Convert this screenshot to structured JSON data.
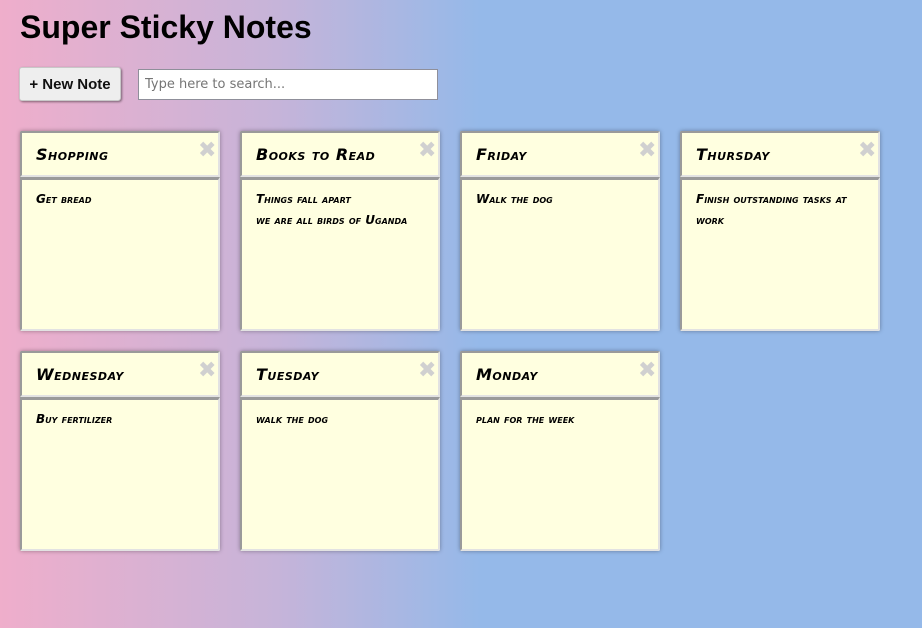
{
  "app": {
    "title": "Super Sticky Notes"
  },
  "toolbar": {
    "new_note_label": "+ New Note",
    "search_placeholder": "Type here to search...",
    "search_value": ""
  },
  "colors": {
    "note_background": "#ffffe0",
    "gradient_start": "#efaecb",
    "gradient_end": "#95b9e9",
    "close_icon": "#d0d0d0"
  },
  "notes": [
    {
      "title": "Shopping",
      "body": "Get bread",
      "close_icon": "close-x"
    },
    {
      "title": "Books to Read",
      "body": "Things fall apart\nwe are all birds of Uganda",
      "close_icon": "close-x"
    },
    {
      "title": "Friday",
      "body": "Walk the dog",
      "close_icon": "close-x"
    },
    {
      "title": "Thursday",
      "body": "Finish outstanding tasks at work",
      "close_icon": "close-x"
    },
    {
      "title": "Wednesday",
      "body": "Buy fertilizer",
      "close_icon": "close-x"
    },
    {
      "title": "Tuesday",
      "body": "walk the dog",
      "close_icon": "close-x"
    },
    {
      "title": "Monday",
      "body": "plan for the week",
      "close_icon": "close-x"
    }
  ]
}
